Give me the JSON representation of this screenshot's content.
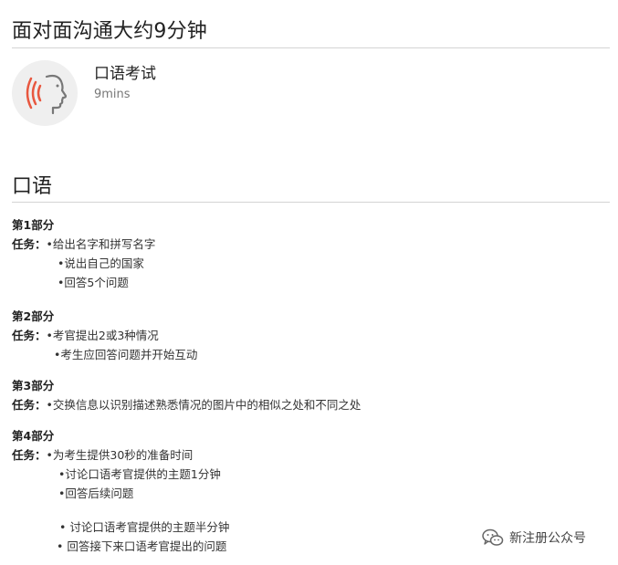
{
  "header": {
    "title": "面对面沟通大约9分钟"
  },
  "exam": {
    "title": "口语考试",
    "duration": "9mins",
    "icon": "speaking-head-icon"
  },
  "section_heading": "口语",
  "task_label": "任务：",
  "parts": [
    {
      "title": "第1部分",
      "items": [
        "•给出名字和拼写名字",
        "•说出自己的国家",
        "•回答5个问题"
      ]
    },
    {
      "title": "第2部分",
      "items": [
        "•考官提出2或3种情况",
        "•考生应回答问题并开始互动"
      ]
    },
    {
      "title": "第3部分",
      "items": [
        "•交换信息以识别描述熟悉情况的图片中的相似之处和不同之处"
      ]
    },
    {
      "title": "第4部分",
      "items": [
        "•为考生提供30秒的准备时间",
        "•讨论口语考官提供的主题1分钟",
        "•回答后续问题"
      ]
    }
  ],
  "extra_items": [
    "• 讨论口语考官提供的主题半分钟",
    "• 回答接下来口语考官提出的问题"
  ],
  "watermark": {
    "text": "新注册公众号",
    "icon": "wechat-icon"
  },
  "colors": {
    "accent": "#e8573f",
    "rule": "#d4d4d4"
  }
}
